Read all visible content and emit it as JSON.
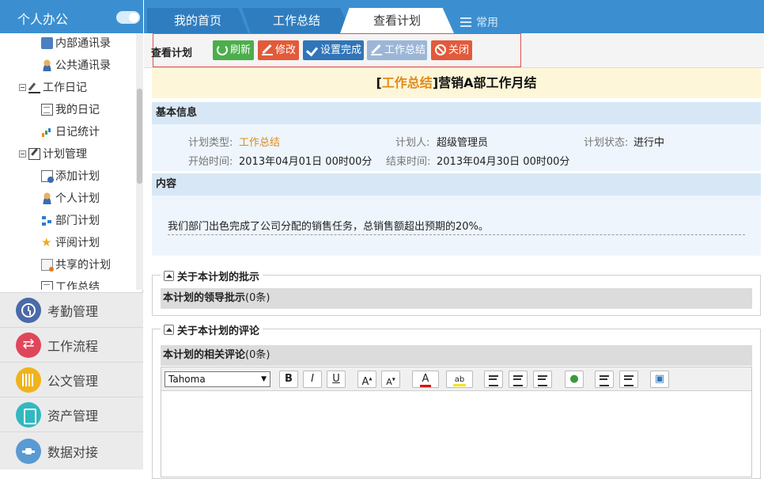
{
  "sidebar": {
    "title": "个人办公",
    "tree": [
      {
        "label": "内部通讯录",
        "icon": "address-book-icon"
      },
      {
        "label": "公共通讯录",
        "icon": "contacts-icon"
      },
      {
        "label": "工作日记",
        "icon": "pencil-icon"
      },
      {
        "label": "我的日记",
        "icon": "diary-icon"
      },
      {
        "label": "日记统计",
        "icon": "bar-chart-icon"
      },
      {
        "label": "计划管理",
        "icon": "edit-icon"
      },
      {
        "label": "添加计划",
        "icon": "add-plan-icon"
      },
      {
        "label": "个人计划",
        "icon": "person-icon"
      },
      {
        "label": "部门计划",
        "icon": "org-chart-icon"
      },
      {
        "label": "评阅计划",
        "icon": "star-icon"
      },
      {
        "label": "共享的计划",
        "icon": "share-icon"
      },
      {
        "label": "工作总结",
        "icon": "summary-icon"
      }
    ],
    "modules": [
      {
        "label": "考勤管理",
        "icon": "clock-icon"
      },
      {
        "label": "工作流程",
        "icon": "workflow-icon"
      },
      {
        "label": "公文管理",
        "icon": "document-icon"
      },
      {
        "label": "资产管理",
        "icon": "asset-icon"
      },
      {
        "label": "数据对接",
        "icon": "data-link-icon"
      }
    ]
  },
  "tabs": [
    {
      "label": "我的首页"
    },
    {
      "label": "工作总结"
    },
    {
      "label": "查看计划"
    }
  ],
  "tabs_common": "常用",
  "toolbar": {
    "title": "查看计划",
    "refresh": "刷新",
    "edit": "修改",
    "set_done": "设置完成",
    "summary": "工作总结",
    "close": "关闭"
  },
  "plan": {
    "title_tag": "工作总结",
    "bracket_open": "[",
    "bracket_close": "]",
    "title": "营销A部工作月结",
    "basic_info_header": "基本信息",
    "type_label": "计划类型:",
    "type_value": "工作总结",
    "owner_label": "计划人:",
    "owner_value": "超级管理员",
    "status_label": "计划状态:",
    "status_value": "进行中",
    "start_label": "开始时间:",
    "start_value": "2013年04月01日 00时00分",
    "end_label": "结束时间:",
    "end_value": "2013年04月30日 00时00分",
    "content_header": "内容",
    "content_text": "我们部门出色完成了公司分配的销售任务，总销售额超出预期的20%。"
  },
  "approval": {
    "legend": "关于本计划的批示",
    "bar_label": "本计划的领导批示",
    "bar_count": "(0条)"
  },
  "comments": {
    "legend": "关于本计划的评论",
    "bar_label": "本计划的相关评论",
    "bar_count": "(0条)",
    "font_value": "Tahoma"
  },
  "colors": {
    "primary": "#3b8fd0",
    "accent_orange": "#e08a1c",
    "btn_green": "#4cae4c",
    "btn_red": "#e25a3a",
    "btn_blue": "#3075b8"
  }
}
